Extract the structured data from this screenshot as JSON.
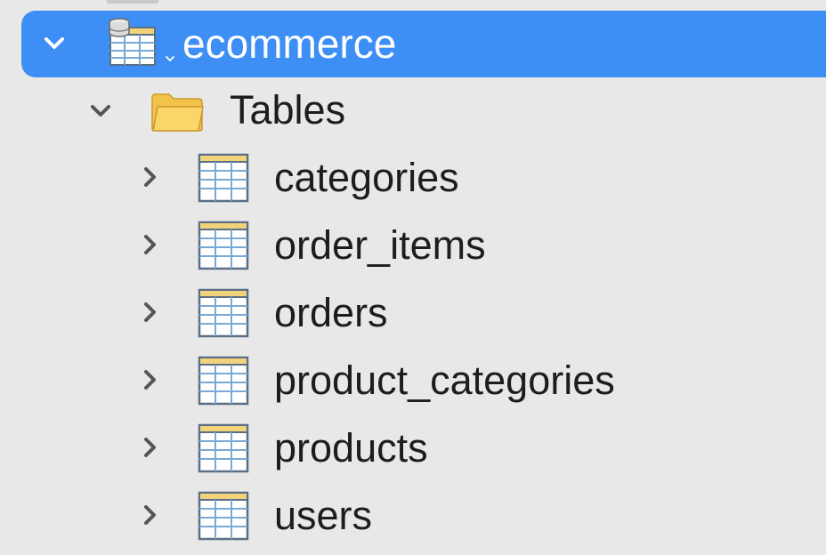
{
  "tree": {
    "database": {
      "name": "ecommerce",
      "expanded": true,
      "selected": true,
      "icon": "database-table-icon",
      "color_selected": "#3d8ef5"
    },
    "group": {
      "label": "Tables",
      "expanded": true,
      "icon": "folder-icon"
    },
    "tables": [
      {
        "label": "categories",
        "icon": "table-icon",
        "expanded": false
      },
      {
        "label": "order_items",
        "icon": "table-icon",
        "expanded": false
      },
      {
        "label": "orders",
        "icon": "table-icon",
        "expanded": false
      },
      {
        "label": "product_categories",
        "icon": "table-icon",
        "expanded": false
      },
      {
        "label": "products",
        "icon": "table-icon",
        "expanded": false
      },
      {
        "label": "users",
        "icon": "table-icon",
        "expanded": false
      }
    ]
  }
}
